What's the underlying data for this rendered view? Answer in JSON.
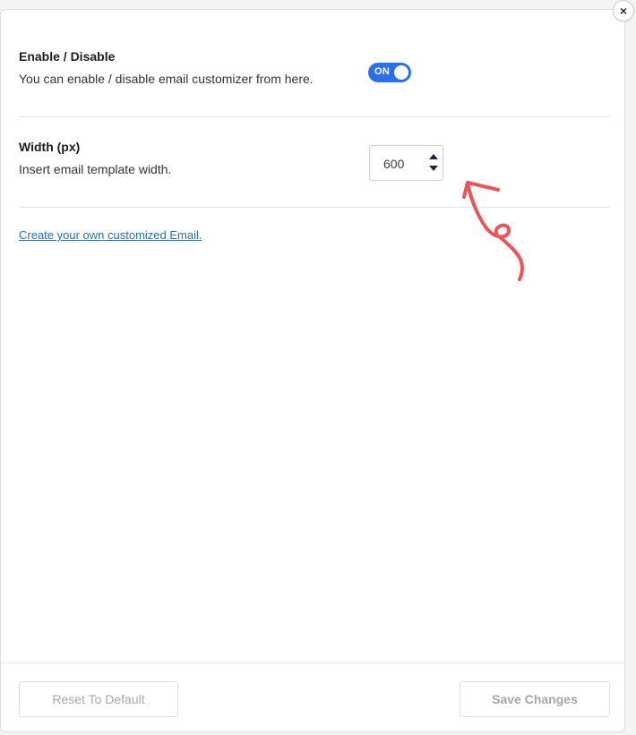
{
  "settings": {
    "enable": {
      "title": "Enable / Disable",
      "description": "You can enable / disable email customizer from here.",
      "toggle_label": "ON",
      "toggle_state": "on"
    },
    "width": {
      "title": "Width (px)",
      "description": "Insert email template width.",
      "value": "600"
    },
    "link_text": "Create your own customized Email."
  },
  "footer": {
    "reset_label": "Reset To Default",
    "save_label": "Save Changes"
  },
  "colors": {
    "toggle_on": "#2d6fe8",
    "link": "#2271b1",
    "annotation_arrow": "#e8555a"
  },
  "icons": {
    "close": "close-icon",
    "spin_up": "chevron-up-icon",
    "spin_down": "chevron-down-icon"
  },
  "close_symbol": "×"
}
